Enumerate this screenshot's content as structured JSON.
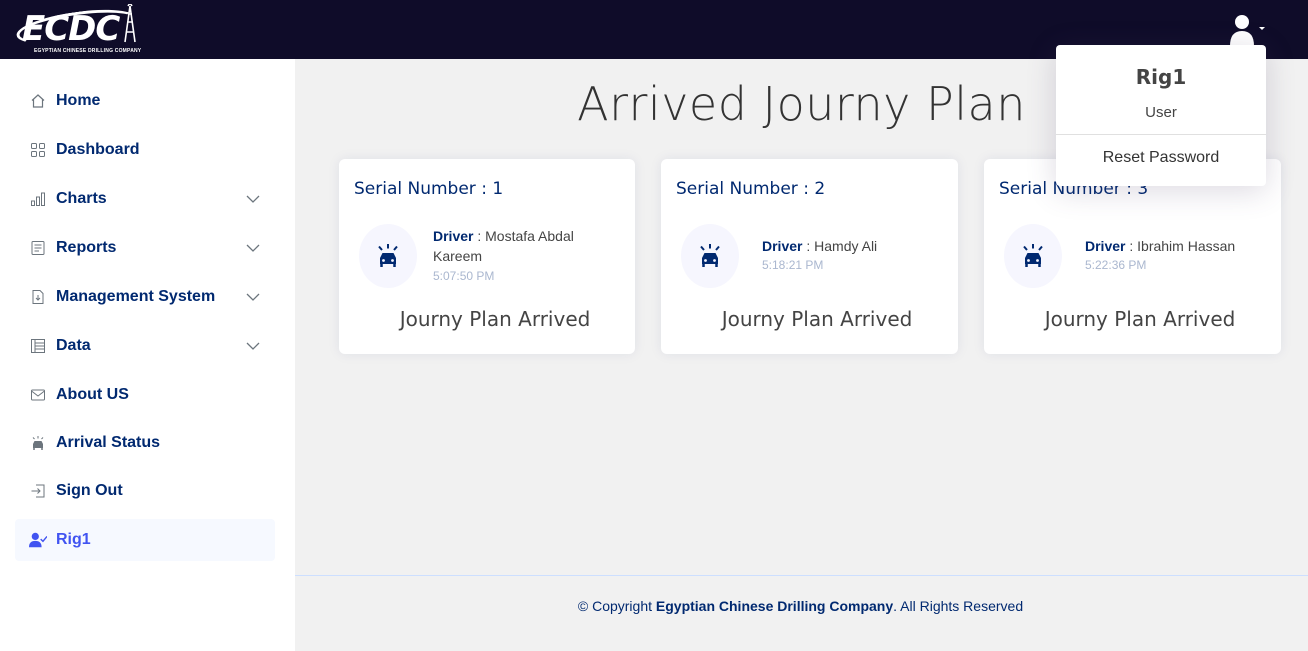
{
  "header": {
    "logo_text": "ECDC",
    "logo_subtitle": "EGYPTIAN CHINESE DRILLING COMPANY"
  },
  "sidebar": {
    "items": [
      {
        "label": "Home",
        "icon": "house-icon",
        "has_chevron": false
      },
      {
        "label": "Dashboard",
        "icon": "grid-icon",
        "has_chevron": false
      },
      {
        "label": "Charts",
        "icon": "bar-chart-icon",
        "has_chevron": true
      },
      {
        "label": "Reports",
        "icon": "report-icon",
        "has_chevron": true
      },
      {
        "label": "Management System",
        "icon": "file-arrow-icon",
        "has_chevron": true
      },
      {
        "label": "Data",
        "icon": "table-icon",
        "has_chevron": true
      },
      {
        "label": "About US",
        "icon": "envelope-icon",
        "has_chevron": false
      },
      {
        "label": "Arrival Status",
        "icon": "car-alarm-icon",
        "has_chevron": false
      },
      {
        "label": "Sign Out",
        "icon": "sign-out-icon",
        "has_chevron": false
      },
      {
        "label": "Rig1",
        "icon": "person-check-icon",
        "has_chevron": false,
        "active": true
      }
    ]
  },
  "main": {
    "title": "Arrived Journy Plan",
    "cards": [
      {
        "serial": "Serial Number : 1",
        "driver_key": "Driver",
        "driver_name": "Mostafa Abdal Kareem",
        "time": "5:07:50 PM",
        "status": "Journy Plan Arrived"
      },
      {
        "serial": "Serial Number : 2",
        "driver_key": "Driver",
        "driver_name": "Hamdy Ali",
        "time": "5:18:21 PM",
        "status": "Journy Plan Arrived"
      },
      {
        "serial": "Serial Number : 3",
        "driver_key": "Driver",
        "driver_name": "Ibrahim Hassan",
        "time": "5:22:36 PM",
        "status": "Journy Plan Arrived"
      }
    ]
  },
  "footer": {
    "prefix": "© Copyright ",
    "company": "Egyptian Chinese Drilling Company",
    "suffix": ". All Rights Reserved"
  },
  "profile_dropdown": {
    "name": "Rig1",
    "role": "User",
    "reset_label": "Reset Password"
  },
  "colors": {
    "topbar": "#0f0c29",
    "nav_text": "#012970",
    "accent": "#4154f1"
  }
}
